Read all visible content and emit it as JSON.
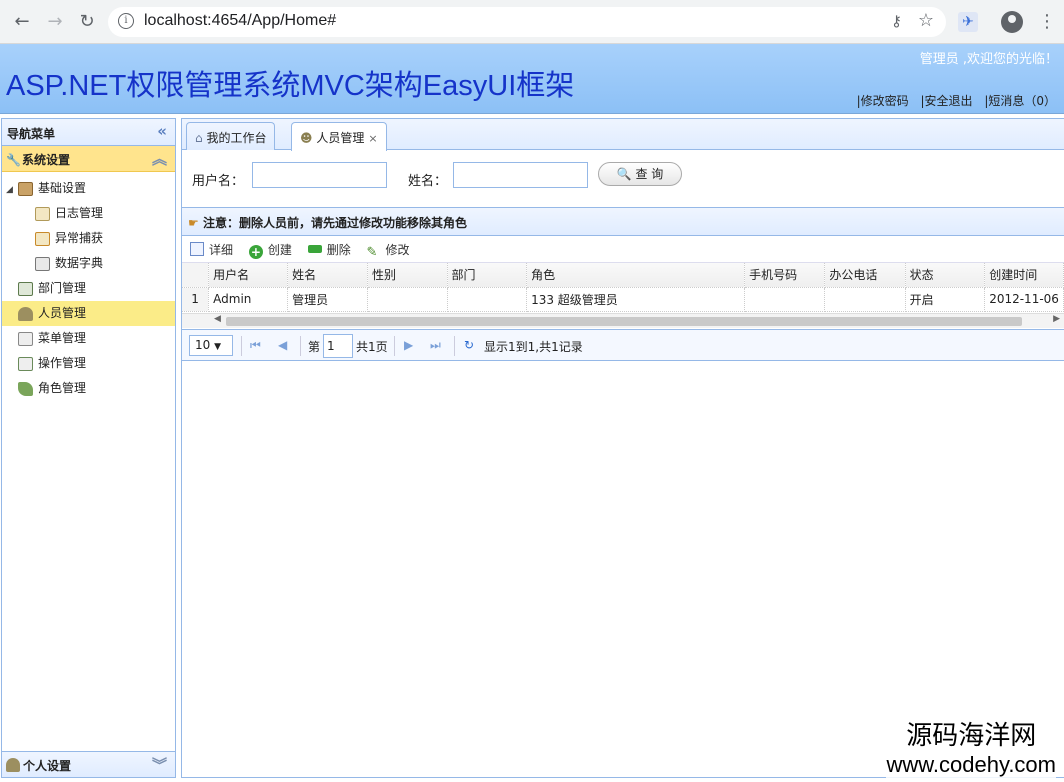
{
  "browser": {
    "url": "localhost:4654/App/Home#"
  },
  "banner": {
    "title": "ASP.NET权限管理系统MVC架构EasyUI框架",
    "welcome": "管理员 ,欢迎您的光临！",
    "links": [
      "|修改密码",
      "|安全退出",
      "|短消息（0）"
    ]
  },
  "sidebar": {
    "title": "导航菜单",
    "section": "系统设置",
    "items": [
      {
        "label": "基础设置"
      },
      {
        "label": "日志管理"
      },
      {
        "label": "异常捕获"
      },
      {
        "label": "数据字典"
      },
      {
        "label": "部门管理"
      },
      {
        "label": "人员管理"
      },
      {
        "label": "菜单管理"
      },
      {
        "label": "操作管理"
      },
      {
        "label": "角色管理"
      }
    ],
    "bottom_section": "个人设置"
  },
  "tabs": [
    {
      "label": "我的工作台"
    },
    {
      "label": "人员管理",
      "close": "×"
    }
  ],
  "search": {
    "username_label": "用户名：",
    "name_label": "姓名：",
    "query_button": "查 询"
  },
  "notice": "注意：删除人员前，请先通过修改功能移除其角色",
  "toolbar": {
    "detail": "详细",
    "create": "创建",
    "delete": "删除",
    "edit": "修改"
  },
  "table": {
    "columns": [
      "用户名",
      "姓名",
      "性别",
      "部门",
      "角色",
      "手机号码",
      "办公电话",
      "状态",
      "创建时间"
    ],
    "rows": [
      {
        "num": "1",
        "cells": [
          "Admin",
          "管理员",
          "",
          "",
          "133 超级管理员",
          "",
          "",
          "开启",
          "2012-11-06"
        ]
      }
    ]
  },
  "pager": {
    "page_size": "10",
    "page_prefix": "第",
    "page_number": "1",
    "page_total": "共1页",
    "summary": "显示1到1,共1记录"
  },
  "watermark": {
    "cn": "源码海洋网",
    "en": "www.codehy.com"
  }
}
